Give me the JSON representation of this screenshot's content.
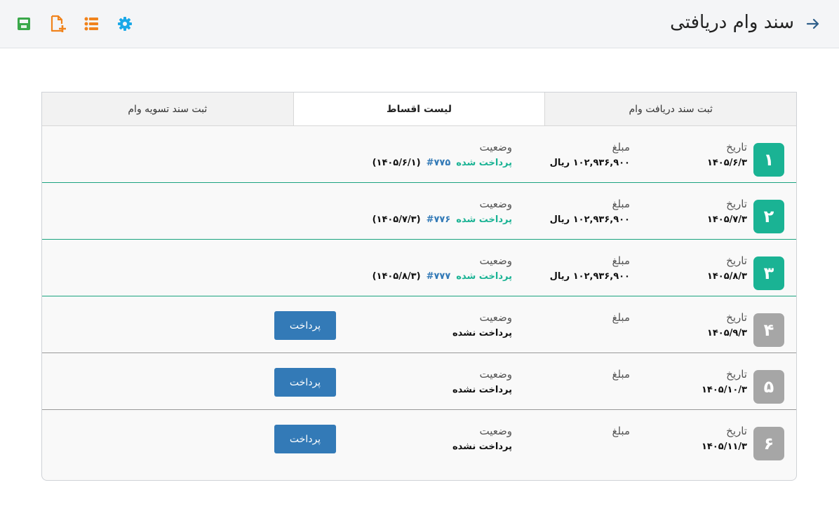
{
  "header": {
    "title": "سند وام دریافتی",
    "back_icon": "arrow-right-icon",
    "toolbar_icons": [
      "settings-icon",
      "list-icon",
      "add-document-icon",
      "save-icon"
    ],
    "colors": {
      "settings": "#1aa8e8",
      "list": "#f0831c",
      "add": "#f0831c",
      "save": "#3aa84a"
    }
  },
  "tabs": [
    {
      "label": "ثبت سند دریافت وام",
      "active": false
    },
    {
      "label": "لیست اقساط",
      "active": true
    },
    {
      "label": "ثبت سند تسویه وام",
      "active": false
    }
  ],
  "labels": {
    "date": "تاریخ",
    "amount": "مبلغ",
    "status": "وضعیت",
    "pay_button": "پرداخت"
  },
  "installments": [
    {
      "number": "۱",
      "date": "۱۴۰۵/۶/۳",
      "amount": "۱۰۲,۹۳۶,۹۰۰ ریال",
      "status": "پرداخت شده",
      "doc_no": "#۷۷۵",
      "paid_date": "(۱۴۰۵/۶/۱)",
      "paid": true
    },
    {
      "number": "۲",
      "date": "۱۴۰۵/۷/۳",
      "amount": "۱۰۲,۹۳۶,۹۰۰ ریال",
      "status": "پرداخت شده",
      "doc_no": "#۷۷۶",
      "paid_date": "(۱۴۰۵/۷/۳)",
      "paid": true
    },
    {
      "number": "۳",
      "date": "۱۴۰۵/۸/۳",
      "amount": "۱۰۲,۹۳۶,۹۰۰ ریال",
      "status": "پرداخت شده",
      "doc_no": "#۷۷۷",
      "paid_date": "(۱۴۰۵/۸/۳)",
      "paid": true
    },
    {
      "number": "۴",
      "date": "۱۴۰۵/۹/۳",
      "amount": "",
      "status": "پرداخت نشده",
      "paid": false
    },
    {
      "number": "۵",
      "date": "۱۴۰۵/۱۰/۳",
      "amount": "",
      "status": "پرداخت نشده",
      "paid": false
    },
    {
      "number": "۶",
      "date": "۱۴۰۵/۱۱/۳",
      "amount": "",
      "status": "پرداخت نشده",
      "paid": false
    }
  ]
}
